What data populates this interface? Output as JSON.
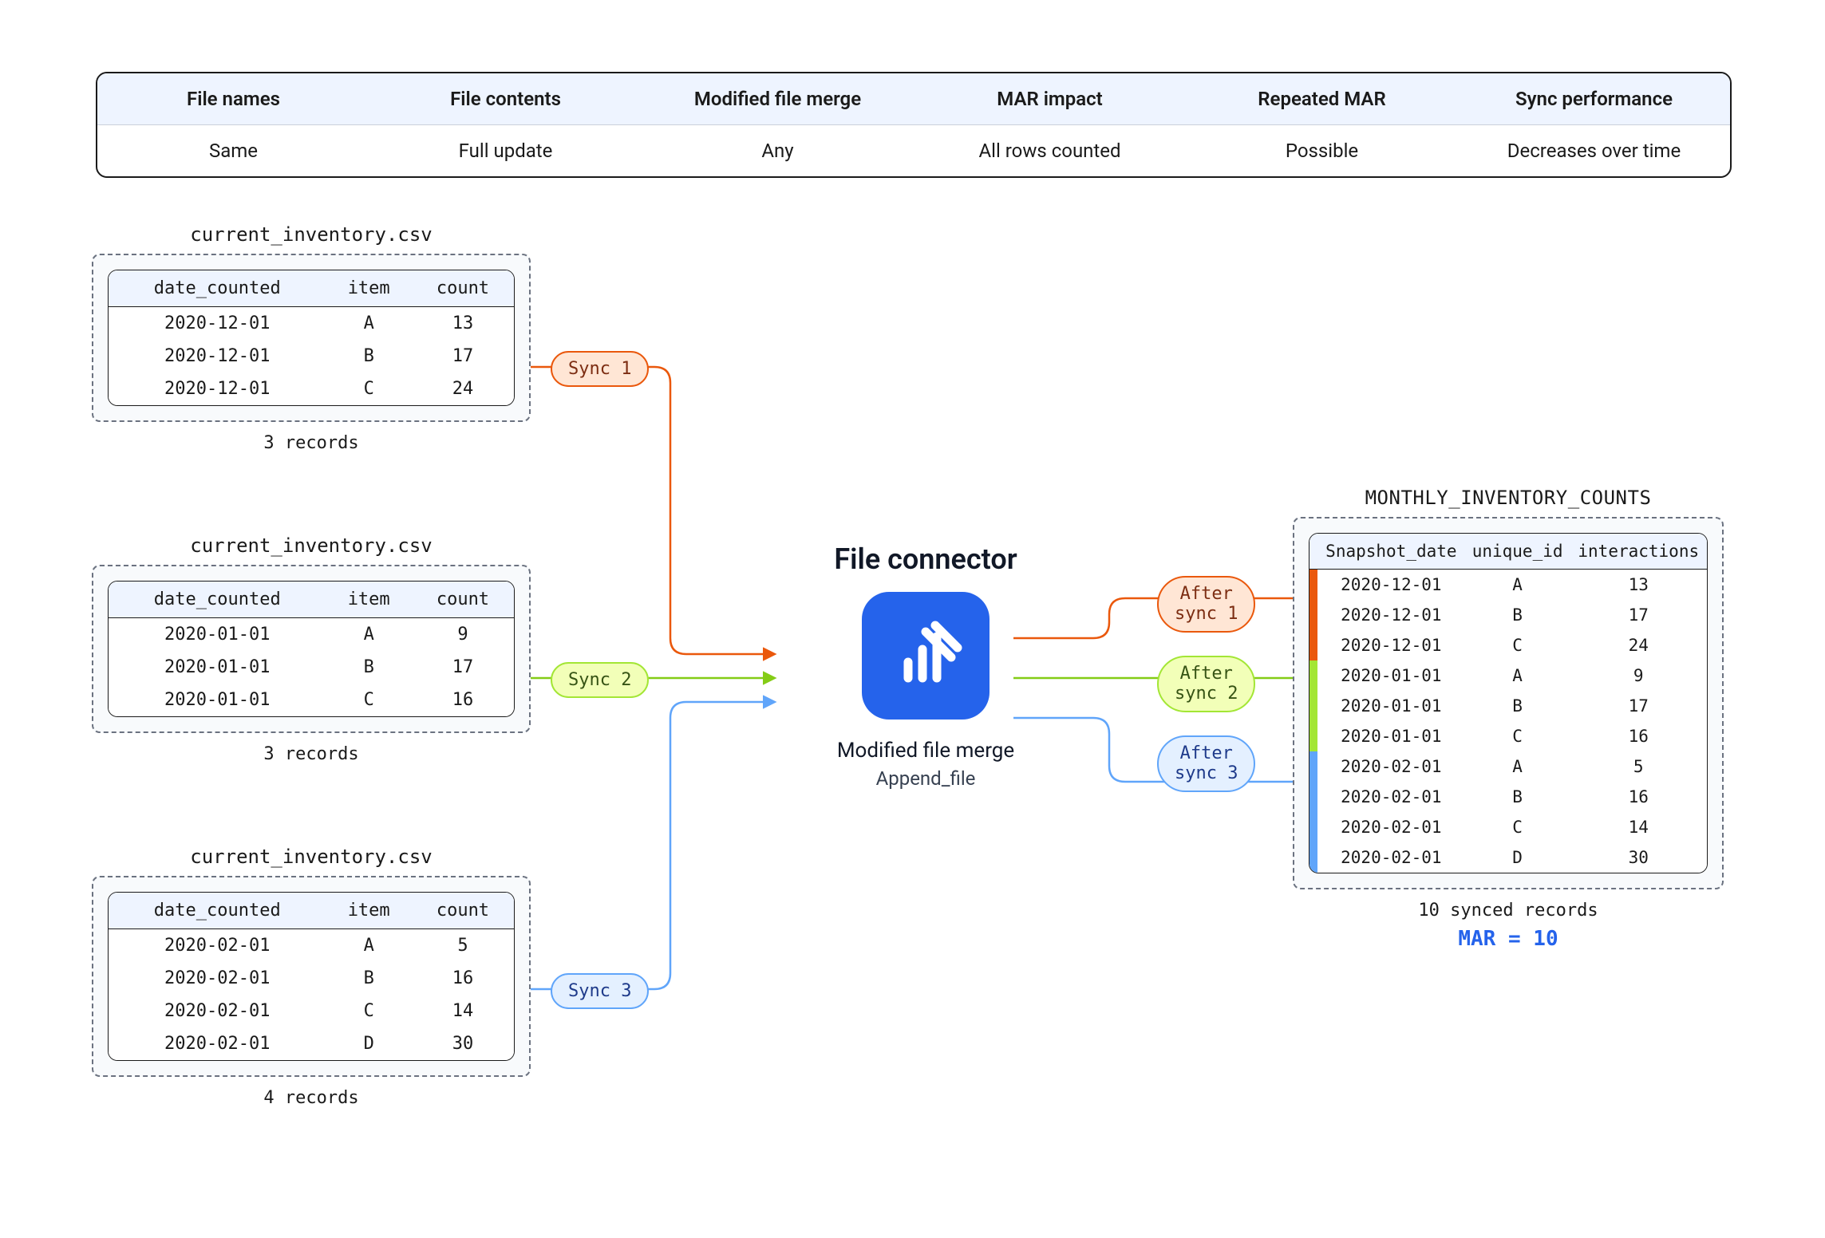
{
  "summary": {
    "headers": [
      "File names",
      "File contents",
      "Modified file merge",
      "MAR impact",
      "Repeated MAR",
      "Sync performance"
    ],
    "values": [
      "Same",
      "Full update",
      "Any",
      "All rows counted",
      "Possible",
      "Decreases over time"
    ]
  },
  "source_columns": [
    "date_counted",
    "item",
    "count"
  ],
  "sources": [
    {
      "filename": "current_inventory.csv",
      "rows": [
        [
          "2020-12-01",
          "A",
          "13"
        ],
        [
          "2020-12-01",
          "B",
          "17"
        ],
        [
          "2020-12-01",
          "C",
          "24"
        ]
      ],
      "caption": "3 records",
      "sync_label": "Sync 1"
    },
    {
      "filename": "current_inventory.csv",
      "rows": [
        [
          "2020-01-01",
          "A",
          "9"
        ],
        [
          "2020-01-01",
          "B",
          "17"
        ],
        [
          "2020-01-01",
          "C",
          "16"
        ]
      ],
      "caption": "3 records",
      "sync_label": "Sync 2"
    },
    {
      "filename": "current_inventory.csv",
      "rows": [
        [
          "2020-02-01",
          "A",
          "5"
        ],
        [
          "2020-02-01",
          "B",
          "16"
        ],
        [
          "2020-02-01",
          "C",
          "14"
        ],
        [
          "2020-02-01",
          "D",
          "30"
        ]
      ],
      "caption": "4 records",
      "sync_label": "Sync 3"
    }
  ],
  "connector": {
    "title": "File connector",
    "merge_label": "Modified file merge",
    "merge_value": "Append_file"
  },
  "after_sync_labels": [
    "After\nsync 1",
    "After\nsync 2",
    "After\nsync 3"
  ],
  "output": {
    "title": "MONTHLY_INVENTORY_COUNTS",
    "columns": [
      "Snapshot_date",
      "unique_id",
      "interactions"
    ],
    "rows": [
      {
        "stripe": 1,
        "cells": [
          "2020-12-01",
          "A",
          "13"
        ]
      },
      {
        "stripe": 1,
        "cells": [
          "2020-12-01",
          "B",
          "17"
        ]
      },
      {
        "stripe": 1,
        "cells": [
          "2020-12-01",
          "C",
          "24"
        ]
      },
      {
        "stripe": 2,
        "cells": [
          "2020-01-01",
          "A",
          "9"
        ]
      },
      {
        "stripe": 2,
        "cells": [
          "2020-01-01",
          "B",
          "17"
        ]
      },
      {
        "stripe": 2,
        "cells": [
          "2020-01-01",
          "C",
          "16"
        ]
      },
      {
        "stripe": 3,
        "cells": [
          "2020-02-01",
          "A",
          "5"
        ]
      },
      {
        "stripe": 3,
        "cells": [
          "2020-02-01",
          "B",
          "16"
        ]
      },
      {
        "stripe": 3,
        "cells": [
          "2020-02-01",
          "C",
          "14"
        ]
      },
      {
        "stripe": 3,
        "cells": [
          "2020-02-01",
          "D",
          "30"
        ]
      }
    ],
    "caption": "10 synced records",
    "mar": "MAR = 10"
  },
  "colors": {
    "sync1": "#ea580c",
    "sync2": "#a3e635",
    "sync3": "#60a5fa"
  }
}
